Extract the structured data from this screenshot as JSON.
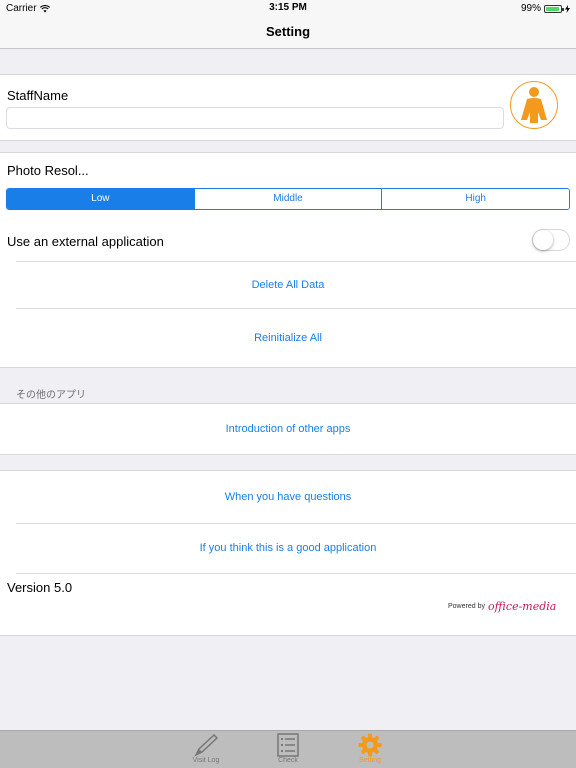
{
  "status_bar": {
    "carrier": "Carrier",
    "time": "3:15 PM",
    "battery": "99%"
  },
  "nav": {
    "title": "Setting"
  },
  "staff": {
    "label": "StaffName",
    "value": "",
    "avatar_icon": "person-icon"
  },
  "photo": {
    "label": "Photo Resol...",
    "options": [
      "Low",
      "Middle",
      "High"
    ],
    "selected": "Low"
  },
  "external_app": {
    "label": "Use an external application",
    "enabled": false
  },
  "actions": {
    "delete_all": "Delete All Data",
    "reinitialize": "Reinitialize All"
  },
  "other_apps": {
    "header": "その他のアプリ",
    "intro": "Introduction of other apps"
  },
  "support": {
    "questions": "When you have questions",
    "good_app": "If you think this is a good application",
    "version": "Version 5.0",
    "powered_by": "Powered by",
    "brand": "office-media"
  },
  "tabs": [
    {
      "label": "Visit Log",
      "icon": "pencil-icon",
      "active": false
    },
    {
      "label": "Check",
      "icon": "checklist-icon",
      "active": false
    },
    {
      "label": "Setting",
      "icon": "gear-icon",
      "active": true
    }
  ],
  "colors": {
    "accent": "#1a7ee8",
    "orange": "#f39a1c",
    "background": "#efeff4"
  }
}
